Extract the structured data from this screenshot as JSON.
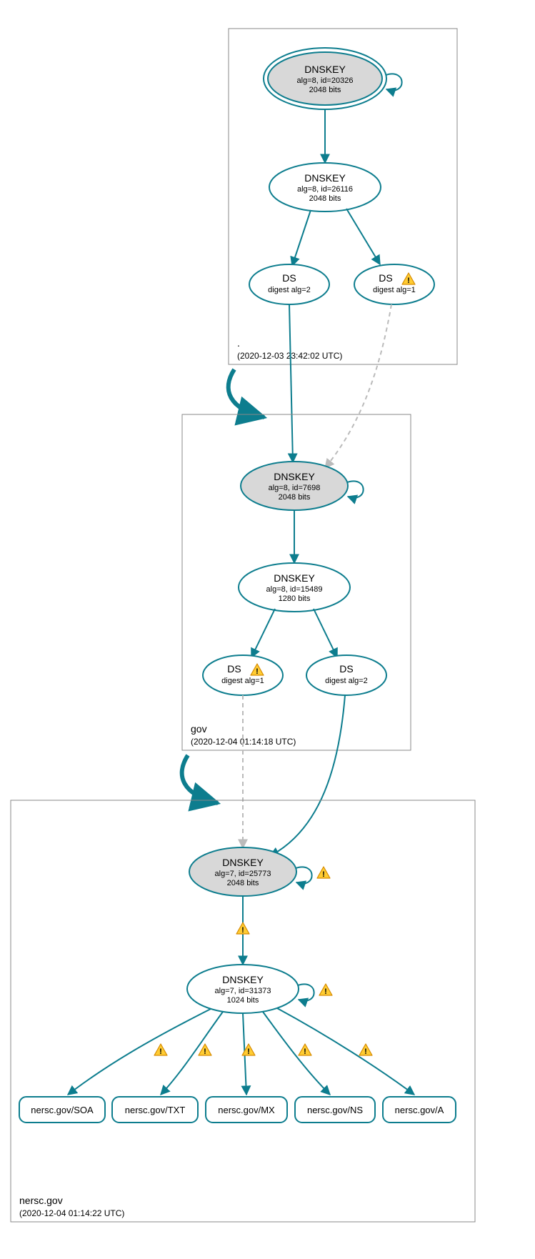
{
  "zones": {
    "root": {
      "name": ".",
      "timestamp": "(2020-12-03 23:42:02 UTC)"
    },
    "gov": {
      "name": "gov",
      "timestamp": "(2020-12-04 01:14:18 UTC)"
    },
    "nersc": {
      "name": "nersc.gov",
      "timestamp": "(2020-12-04 01:14:22 UTC)"
    }
  },
  "nodes": {
    "root_ksk": {
      "title": "DNSKEY",
      "line1": "alg=8, id=20326",
      "line2": "2048 bits"
    },
    "root_zsk": {
      "title": "DNSKEY",
      "line1": "alg=8, id=26116",
      "line2": "2048 bits"
    },
    "root_ds2": {
      "title": "DS",
      "line1": "digest alg=2"
    },
    "root_ds1": {
      "title": "DS",
      "line1": "digest alg=1",
      "warn": true
    },
    "gov_ksk": {
      "title": "DNSKEY",
      "line1": "alg=8, id=7698",
      "line2": "2048 bits"
    },
    "gov_zsk": {
      "title": "DNSKEY",
      "line1": "alg=8, id=15489",
      "line2": "1280 bits"
    },
    "gov_ds1": {
      "title": "DS",
      "line1": "digest alg=1",
      "warn": true
    },
    "gov_ds2": {
      "title": "DS",
      "line1": "digest alg=2"
    },
    "nersc_ksk": {
      "title": "DNSKEY",
      "line1": "alg=7, id=25773",
      "line2": "2048 bits"
    },
    "nersc_zsk": {
      "title": "DNSKEY",
      "line1": "alg=7, id=31373",
      "line2": "1024 bits"
    }
  },
  "records": {
    "soa": "nersc.gov/SOA",
    "txt": "nersc.gov/TXT",
    "mx": "nersc.gov/MX",
    "ns": "nersc.gov/NS",
    "a": "nersc.gov/A"
  },
  "chart_data": {
    "type": "diagram",
    "description": "DNSSEC authentication chain / DNSViz graph",
    "zones": [
      {
        "zone": ".",
        "timestamp": "2020-12-03 23:42:02 UTC",
        "dnskeys": [
          {
            "role": "KSK",
            "alg": 8,
            "id": 20326,
            "bits": 2048,
            "self_loop": true,
            "sep": true
          },
          {
            "role": "ZSK",
            "alg": 8,
            "id": 26116,
            "bits": 2048
          }
        ],
        "ds_to_child": [
          {
            "digest_alg": 2,
            "status": "secure"
          },
          {
            "digest_alg": 1,
            "status": "warning"
          }
        ]
      },
      {
        "zone": "gov",
        "timestamp": "2020-12-04 01:14:18 UTC",
        "dnskeys": [
          {
            "role": "KSK",
            "alg": 8,
            "id": 7698,
            "bits": 2048,
            "self_loop": true
          },
          {
            "role": "ZSK",
            "alg": 8,
            "id": 15489,
            "bits": 1280
          }
        ],
        "ds_to_child": [
          {
            "digest_alg": 1,
            "status": "warning"
          },
          {
            "digest_alg": 2,
            "status": "secure"
          }
        ]
      },
      {
        "zone": "nersc.gov",
        "timestamp": "2020-12-04 01:14:22 UTC",
        "dnskeys": [
          {
            "role": "KSK",
            "alg": 7,
            "id": 25773,
            "bits": 2048,
            "self_loop": true,
            "self_loop_warn": true
          },
          {
            "role": "ZSK",
            "alg": 7,
            "id": 31373,
            "bits": 1024,
            "self_loop": true,
            "self_loop_warn": true
          }
        ],
        "rrsets": [
          {
            "name": "nersc.gov/SOA",
            "sig_warn": true
          },
          {
            "name": "nersc.gov/TXT",
            "sig_warn": true
          },
          {
            "name": "nersc.gov/MX",
            "sig_warn": true
          },
          {
            "name": "nersc.gov/NS",
            "sig_warn": true
          },
          {
            "name": "nersc.gov/A",
            "sig_warn": true
          }
        ],
        "edges": [
          {
            "from": "KSK",
            "to": "ZSK",
            "status": "warning"
          }
        ]
      }
    ],
    "delegation_edges": [
      {
        "from_zone": ".",
        "to_zone": "gov",
        "status": "secure"
      },
      {
        "from_zone": "gov",
        "to_zone": "nersc.gov",
        "status": "secure"
      }
    ]
  }
}
